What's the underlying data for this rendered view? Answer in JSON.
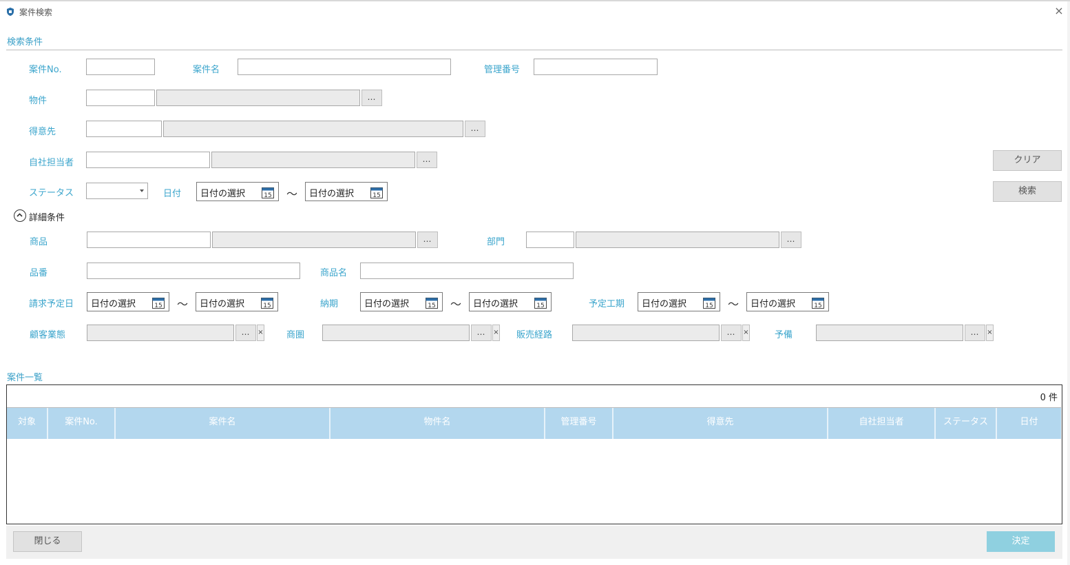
{
  "window": {
    "title": "案件検索",
    "close_glyph": "×"
  },
  "search_section": {
    "title": "検索条件",
    "case_no_label": "案件No.",
    "case_name_label": "案件名",
    "mgmt_no_label": "管理番号",
    "property_label": "物件",
    "customer_label": "得意先",
    "staff_label": "自社担当者",
    "status_label": "ステータス",
    "date_label": "日付",
    "date_from_placeholder": "日付の選択",
    "date_to_placeholder": "日付の選択",
    "tilde": "～",
    "lookup_glyph": "…",
    "clear_button": "クリア",
    "search_button": "検索"
  },
  "detail_section": {
    "toggle_label": "詳細条件",
    "product_label": "商品",
    "dept_label": "部門",
    "part_no_label": "品番",
    "product_name_label": "商品名",
    "billing_date_label": "請求予定日",
    "delivery_label": "納期",
    "schedule_label": "予定工期",
    "date_placeholder": "日付の選択",
    "customer_type_label": "顧客業態",
    "trade_area_label": "商圏",
    "sales_channel_label": "販売経路",
    "reserve_label": "予備",
    "clear_glyph": "×"
  },
  "list_section": {
    "title": "案件一覧",
    "count": "0 件",
    "columns": [
      "対象",
      "案件No.",
      "案件名",
      "物件名",
      "管理番号",
      "得意先",
      "自社担当者",
      "ステータス",
      "日付"
    ]
  },
  "footer": {
    "close_button": "閉じる",
    "ok_button": "決定"
  },
  "colors": {
    "label": "#3ba5cc",
    "header_bg": "#b3d7ee",
    "ok_bg": "#8fd0e0"
  },
  "icons": {
    "app": "shield-logo-icon",
    "calendar": "calendar-15-icon",
    "collapse": "chevron-up-circle-icon"
  }
}
